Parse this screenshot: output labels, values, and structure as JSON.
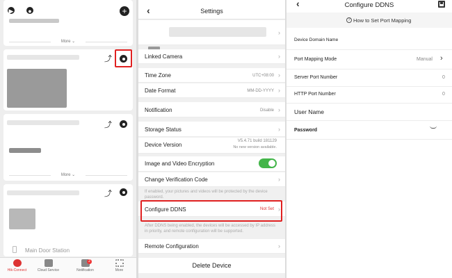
{
  "left": {
    "card1": {
      "more_label": "More"
    },
    "card3": {
      "more_label": "More"
    },
    "device4_name": "Main Door Station",
    "tabbar": [
      {
        "label": "Hik-Connect",
        "active": true
      },
      {
        "label": "Cloud Service",
        "active": false
      },
      {
        "label": "Notification",
        "active": false,
        "badge": "2"
      },
      {
        "label": "More",
        "active": false
      }
    ]
  },
  "settings": {
    "title": "Settings",
    "linked_camera": "Linked Camera",
    "time_zone": {
      "label": "Time Zone",
      "value": "UTC+08:00"
    },
    "date_format": {
      "label": "Date Format",
      "value": "MM-DD-YYYY"
    },
    "notification": {
      "label": "Notification",
      "value": "Disable"
    },
    "storage_status": "Storage Status",
    "device_version": {
      "label": "Device Version",
      "value": "V5.4.71 build 181129",
      "note": "No new version available."
    },
    "encryption": {
      "label": "Image and Video Encryption",
      "enabled": true
    },
    "change_code": "Change Verification Code",
    "encryption_note": "If enabled, your pictures and videos will be protected by the device password.",
    "configure_ddns": {
      "label": "Configure DDNS",
      "value": "Not Set"
    },
    "ddns_note": "After DDNS being enabled, the devices will be accessed by IP address in priority, and remote configuration will be supported.",
    "remote_configuration": "Remote Configuration",
    "delete_device": "Delete Device"
  },
  "ddns": {
    "title": "Configure DDNS",
    "help_link": "How to Set Port Mapping",
    "fields": {
      "domain_name": {
        "label": "Device Domain Name"
      },
      "port_mapping_mode": {
        "label": "Port Mapping Mode",
        "value": "Manual"
      },
      "server_port": {
        "label": "Server Port Number",
        "value": "0"
      },
      "http_port": {
        "label": "HTTP Port Number",
        "value": "0"
      },
      "user_name": {
        "label": "User Name"
      },
      "password": {
        "label": "Password"
      }
    }
  },
  "colors": {
    "highlight_red": "#e02020",
    "toggle_green": "#43b549",
    "active_tab": "#dd3333"
  }
}
